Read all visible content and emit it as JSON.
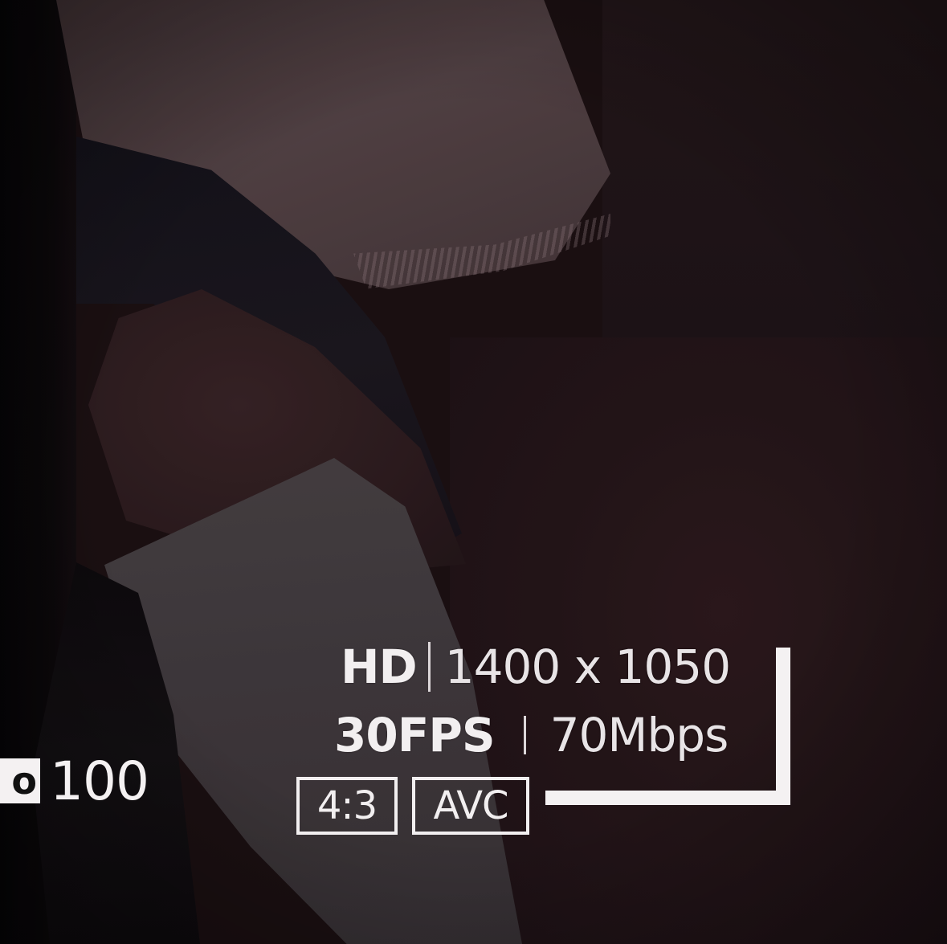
{
  "overlay": {
    "quality": "HD",
    "resolution": "1400 x 1050",
    "frame_rate": "30FPS",
    "bitrate": "70Mbps",
    "aspect_ratio": "4:3",
    "codec": "AVC",
    "iso_label": "o",
    "iso_value": "100"
  },
  "colors": {
    "overlay_text": "#f2eff0",
    "scene_dark": "#1c1013"
  }
}
